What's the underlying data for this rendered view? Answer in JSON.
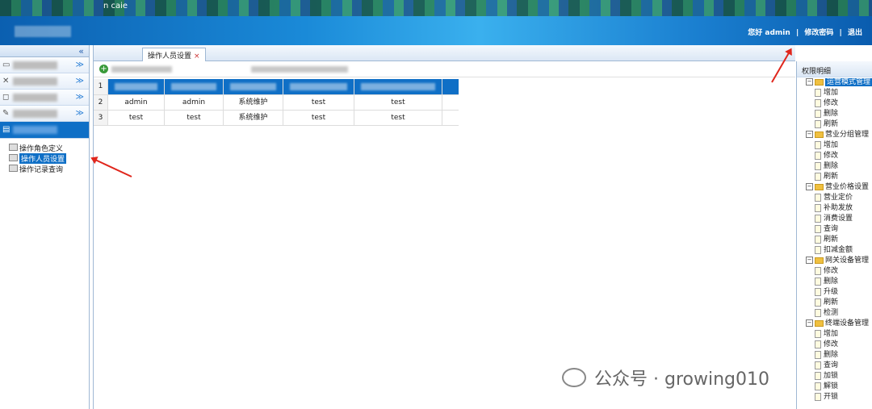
{
  "header": {
    "title": "n caie",
    "user_greeting": "您好 admin",
    "change_password": "修改密码",
    "logout": "退出",
    "sep": "|"
  },
  "left": {
    "collapse": "«",
    "active_menu_icon": "folder-icon",
    "sub_items": [
      {
        "label": "操作角色定义"
      },
      {
        "label": "操作人员设置"
      },
      {
        "label": "操作记录查询"
      }
    ]
  },
  "tabs": [
    {
      "label": "操作人员设置",
      "close": "×"
    }
  ],
  "grid": {
    "row_numbers": [
      "1",
      "2",
      "3"
    ],
    "rows": [
      [
        "admin",
        "admin",
        "系统维护",
        "test",
        "test"
      ],
      [
        "test",
        "test",
        "系统维护",
        "test",
        "test"
      ]
    ]
  },
  "permissions": {
    "title": "权限明细",
    "groups": [
      {
        "name": "运营模式管理",
        "items": [
          "增加",
          "修改",
          "删除",
          "刷新"
        ]
      },
      {
        "name": "营业分组管理",
        "items": [
          "增加",
          "修改",
          "删除",
          "刷新"
        ]
      },
      {
        "name": "营业价格设置",
        "items": [
          "营业定价",
          "补助发放",
          "消费设置",
          "查询",
          "刷新",
          "扣减金额"
        ]
      },
      {
        "name": "网关设备管理",
        "items": [
          "修改",
          "删除",
          "升级",
          "刷新",
          "检测"
        ]
      },
      {
        "name": "终端设备管理",
        "items": [
          "增加",
          "修改",
          "删除",
          "查询",
          "加锁",
          "解锁",
          "开锁"
        ]
      }
    ]
  },
  "watermark": "公众号 · growing010",
  "colors": {
    "accent": "#0f6fc6",
    "arrow": "#e0261c"
  }
}
